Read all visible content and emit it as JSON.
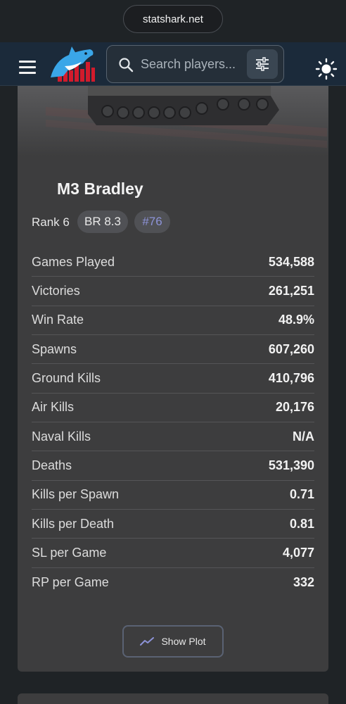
{
  "browser": {
    "url": "statshark.net"
  },
  "nav": {
    "search_placeholder": "Search players...",
    "icons": {
      "menu": "hamburger-menu-icon",
      "logo": "statshark-logo",
      "search": "search-icon",
      "filter": "filter-sliders-icon",
      "theme": "sun-icon"
    }
  },
  "vehicle": {
    "name": "M3 Bradley",
    "rank": "Rank 6",
    "br": "BR 8.3",
    "position": "#76"
  },
  "stats": [
    {
      "label": "Games Played",
      "value": "534,588"
    },
    {
      "label": "Victories",
      "value": "261,251"
    },
    {
      "label": "Win Rate",
      "value": "48.9%"
    },
    {
      "label": "Spawns",
      "value": "607,260"
    },
    {
      "label": "Ground Kills",
      "value": "410,796"
    },
    {
      "label": "Air Kills",
      "value": "20,176"
    },
    {
      "label": "Naval Kills",
      "value": "N/A"
    },
    {
      "label": "Deaths",
      "value": "531,390"
    },
    {
      "label": "Kills per Spawn",
      "value": "0.71"
    },
    {
      "label": "Kills per Death",
      "value": "0.81"
    },
    {
      "label": "SL per Game",
      "value": "4,077"
    },
    {
      "label": "RP per Game",
      "value": "332"
    }
  ],
  "actions": {
    "show_plot": "Show Plot"
  },
  "colors": {
    "accent": "#8d93d8",
    "nav_bg": "#1b2a3a",
    "card_bg": "#3d3d3e"
  }
}
